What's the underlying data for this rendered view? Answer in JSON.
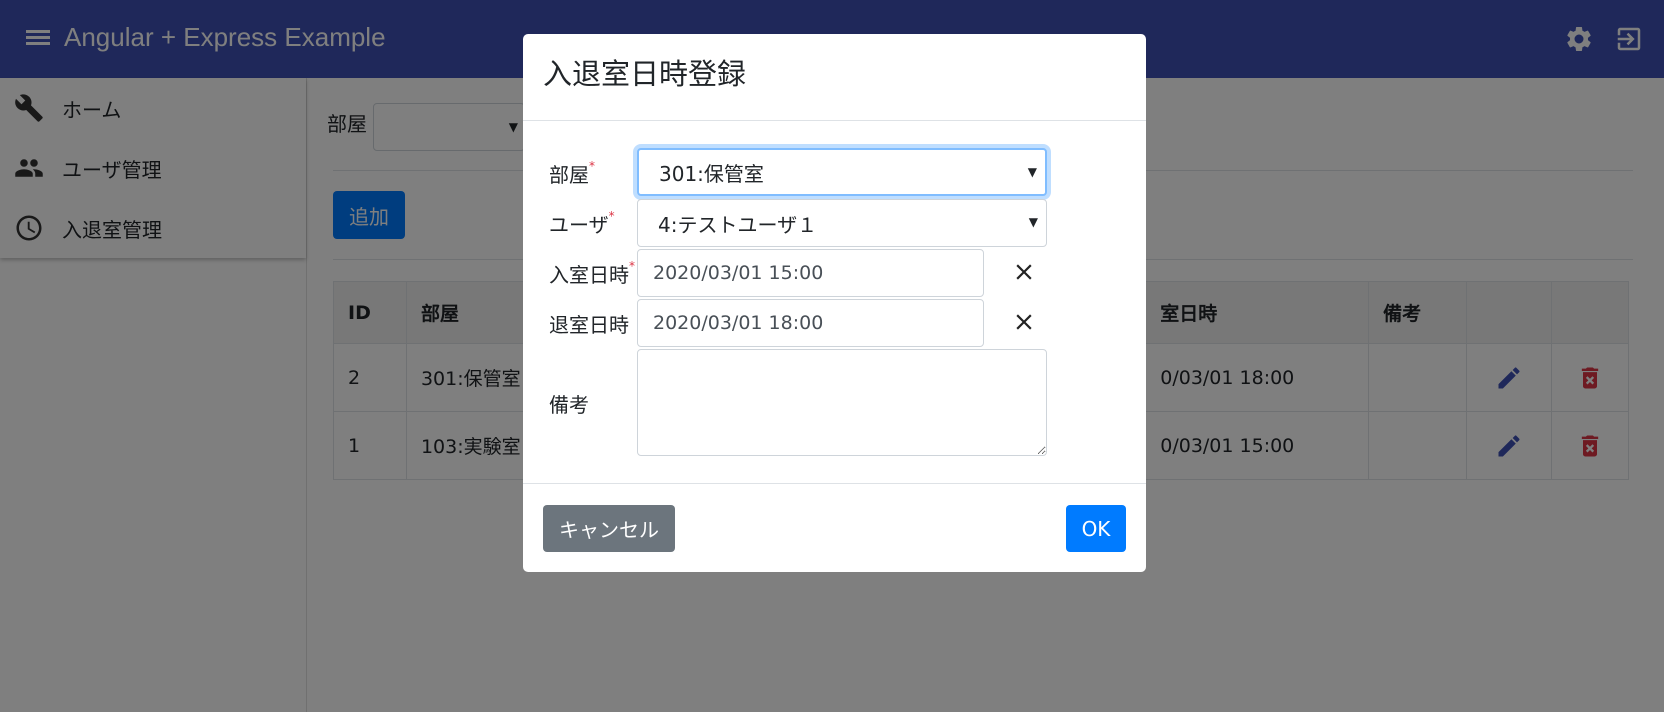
{
  "toolbar": {
    "title": "Angular + Express Example",
    "menu_icon": "menu-icon",
    "settings_icon": "gear-icon",
    "logout_icon": "exit-icon",
    "color": "#3f51b5"
  },
  "sidenav": {
    "items": [
      {
        "label": "ホーム",
        "icon": "wrench-icon"
      },
      {
        "label": "ユーザ管理",
        "icon": "people-icon"
      },
      {
        "label": "入退室管理",
        "icon": "clock-icon"
      }
    ]
  },
  "filter": {
    "room_label": "部屋",
    "room_value": ""
  },
  "actions": {
    "add_label": "追加"
  },
  "table": {
    "headers": [
      "ID",
      "部屋",
      "",
      "",
      "室日時",
      "備考",
      "",
      ""
    ],
    "rows": [
      {
        "id": "2",
        "room": "301:保管室",
        "exit": "0/03/01 18:00",
        "note": ""
      },
      {
        "id": "1",
        "room": "103:実験室",
        "exit": "0/03/01 15:00",
        "note": ""
      }
    ],
    "edit_icon": "pencil-icon",
    "delete_icon": "trash-icon"
  },
  "modal": {
    "title": "入退室日時登録",
    "fields": {
      "room": {
        "label": "部屋",
        "required": "*",
        "value": "301:保管室"
      },
      "user": {
        "label": "ユーザ",
        "required": "*",
        "value": "4:テストユーザ１"
      },
      "entry": {
        "label": "入室日時",
        "required": "*",
        "value": "2020/03/01 15:00"
      },
      "exit": {
        "label": "退室日時",
        "value": "2020/03/01 18:00"
      },
      "note": {
        "label": "備考",
        "value": ""
      }
    },
    "clear_icon": "close-icon",
    "cancel_label": "キャンセル",
    "ok_label": "OK"
  },
  "colors": {
    "primary": "#007bff",
    "secondary": "#6c757d",
    "danger": "#dc3545",
    "focus": "#80bdff"
  }
}
